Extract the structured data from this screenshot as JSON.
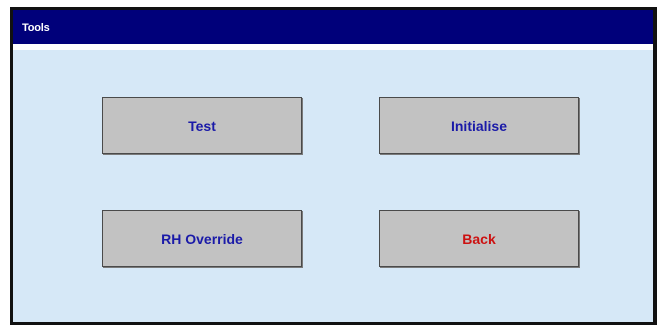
{
  "window": {
    "title": "Tools"
  },
  "buttons": {
    "test": {
      "label": "Test",
      "color": "#1a1aa8"
    },
    "initialise": {
      "label": "Initialise",
      "color": "#1a1aa8"
    },
    "rh_override": {
      "label": "RH Override",
      "color": "#1a1aa8"
    },
    "back": {
      "label": "Back",
      "color": "#cc1111"
    }
  },
  "colors": {
    "titlebar": "#00007a",
    "background": "#d6e8f7",
    "button_face": "#c2c2c2"
  }
}
